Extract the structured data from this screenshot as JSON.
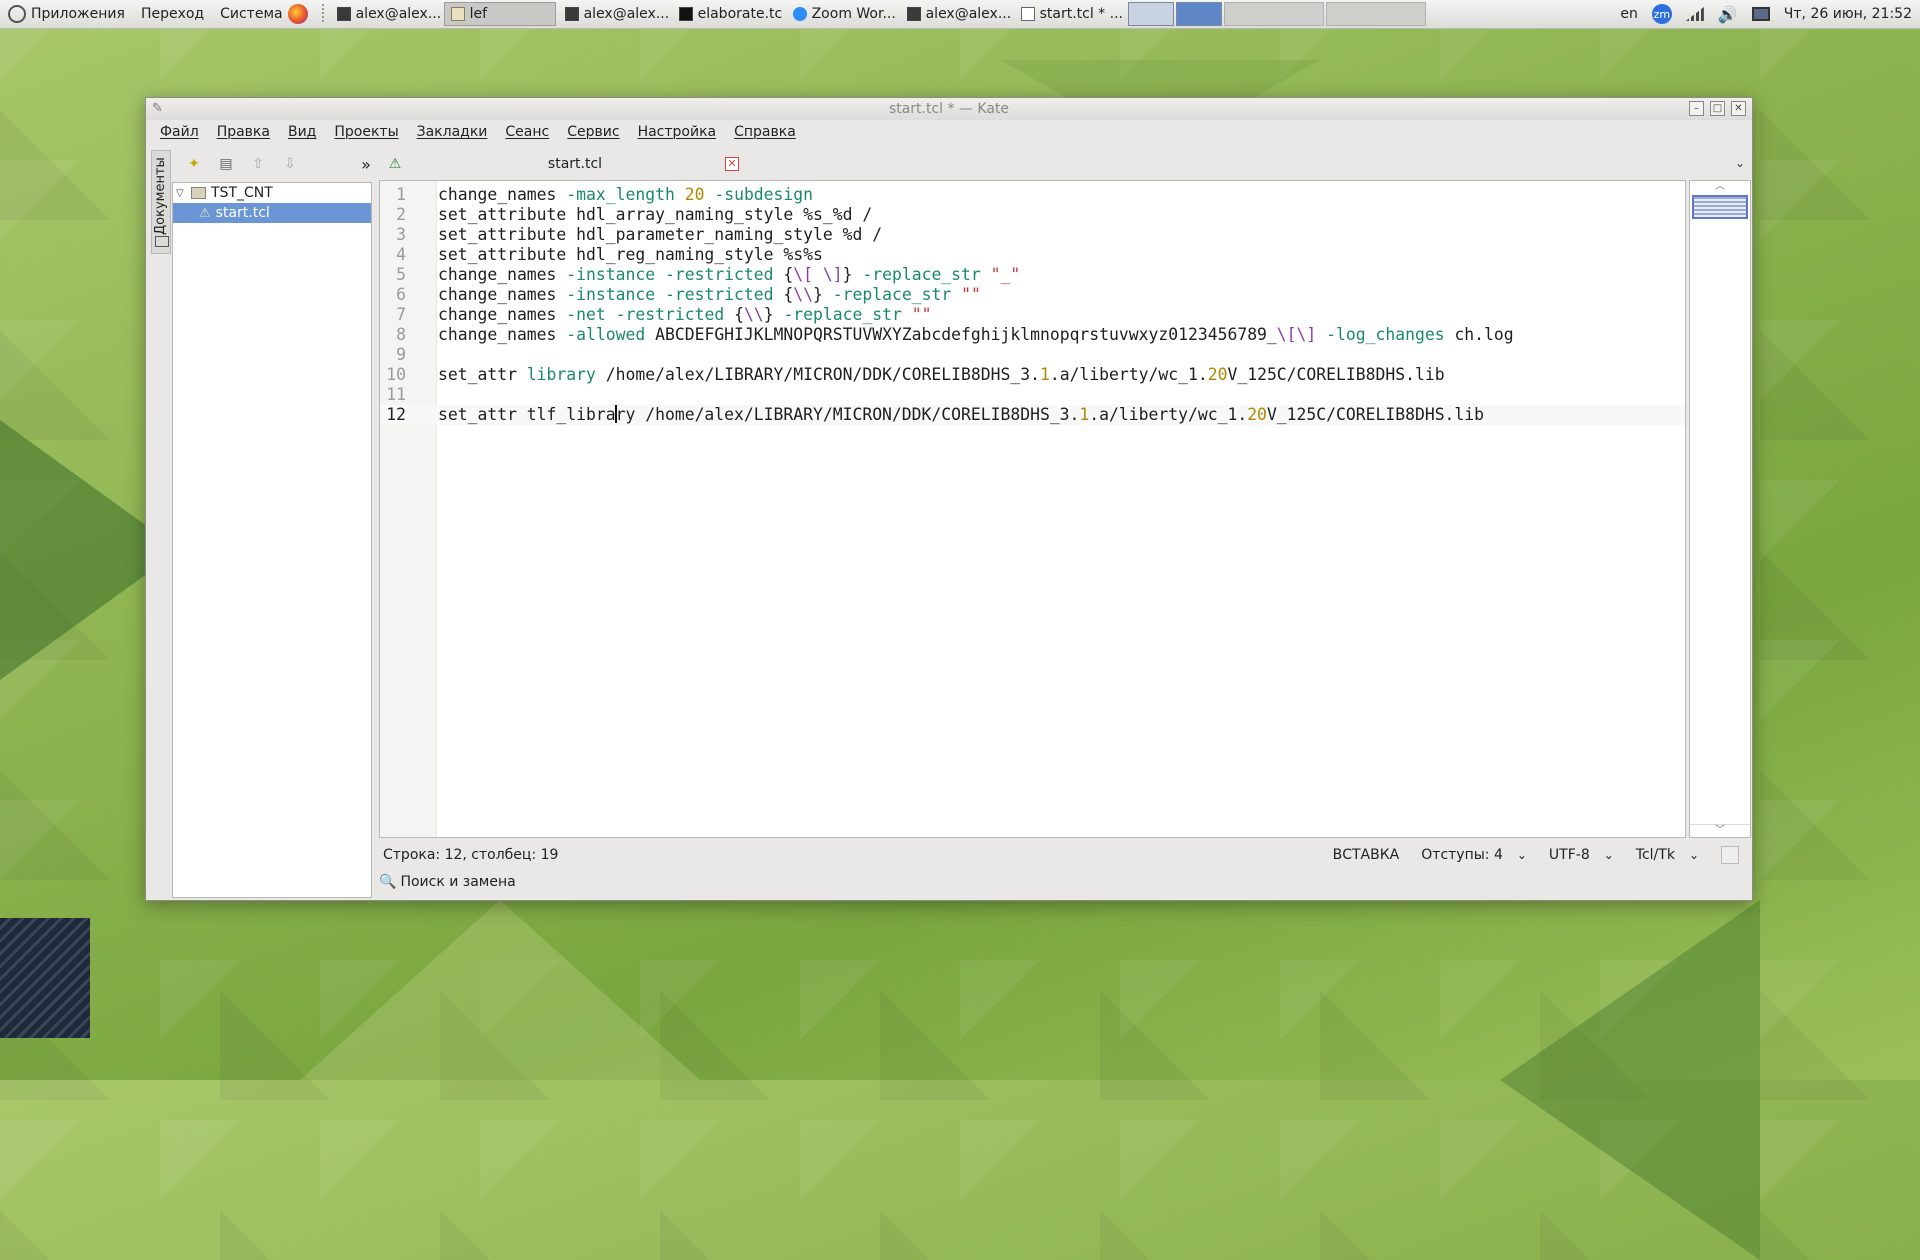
{
  "panel": {
    "menus": [
      "Приложения",
      "Переход",
      "Система"
    ],
    "tasks": [
      {
        "label": "alex@alex...",
        "icon": "terminal-icon"
      },
      {
        "label": "lef",
        "icon": "folder-icon"
      },
      {
        "label": "alex@alex...",
        "icon": "terminal-icon"
      },
      {
        "label": "elaborate.tcl",
        "icon": "terminal-icon"
      },
      {
        "label": "Zoom Wor...",
        "icon": "zoom-icon"
      },
      {
        "label": "alex@alex...",
        "icon": "terminal-icon"
      },
      {
        "label": "start.tcl * ...",
        "icon": "editor-icon"
      }
    ],
    "tray": {
      "lang": "en",
      "zm": "zm",
      "clock": "Чт, 26 июн, 21:52"
    }
  },
  "window": {
    "title": "start.tcl * — Kate",
    "menu": [
      "Файл",
      "Правка",
      "Вид",
      "Проекты",
      "Закладки",
      "Сеанс",
      "Сервис",
      "Настройка",
      "Справка"
    ]
  },
  "sidebar": {
    "tab_label": "Документы",
    "tree": {
      "folder": "TST_CNT",
      "file": "start.tcl"
    }
  },
  "editor": {
    "tab_label": "start.tcl",
    "cursor_line": 12,
    "lines": [
      {
        "n": "1",
        "parts": [
          [
            "",
            "change_names "
          ],
          [
            "kw",
            "-max_length "
          ],
          [
            "num",
            "20"
          ],
          [
            "kw",
            " -subdesign"
          ]
        ]
      },
      {
        "n": "2",
        "parts": [
          [
            "",
            "set_attribute hdl_array_naming_style %s_%d /"
          ]
        ]
      },
      {
        "n": "3",
        "parts": [
          [
            "",
            "set_attribute hdl_parameter_naming_style %d /"
          ]
        ]
      },
      {
        "n": "4",
        "parts": [
          [
            "",
            "set_attribute hdl_reg_naming_style %s%s"
          ]
        ]
      },
      {
        "n": "5",
        "parts": [
          [
            "",
            "change_names "
          ],
          [
            "kw",
            "-instance -restricted "
          ],
          [
            "",
            "{"
          ],
          [
            "esc",
            "\\[ \\]"
          ],
          [
            "",
            "} "
          ],
          [
            "kw",
            "-replace_str "
          ],
          [
            "str",
            "\"_\""
          ]
        ]
      },
      {
        "n": "6",
        "parts": [
          [
            "",
            "change_names "
          ],
          [
            "kw",
            "-instance -restricted "
          ],
          [
            "",
            "{"
          ],
          [
            "esc",
            "\\\\"
          ],
          [
            "",
            "} "
          ],
          [
            "kw",
            "-replace_str "
          ],
          [
            "str",
            "\"\""
          ]
        ]
      },
      {
        "n": "7",
        "parts": [
          [
            "",
            "change_names "
          ],
          [
            "kw",
            "-net -restricted "
          ],
          [
            "",
            "{"
          ],
          [
            "esc",
            "\\\\"
          ],
          [
            "",
            "} "
          ],
          [
            "kw",
            "-replace_str "
          ],
          [
            "str",
            "\"\""
          ]
        ]
      },
      {
        "n": "8",
        "parts": [
          [
            "",
            "change_names "
          ],
          [
            "kw",
            "-allowed "
          ],
          [
            "",
            "ABCDEFGHIJKLMNOPQRSTUVWXYZabcdefghijklmnopqrstuvwxyz0123456789_"
          ],
          [
            "esc",
            "\\[\\]"
          ],
          [
            "kw",
            " -log_changes "
          ],
          [
            "",
            "ch.log"
          ]
        ]
      },
      {
        "n": "9",
        "parts": []
      },
      {
        "n": "10",
        "parts": [
          [
            "",
            "set_attr "
          ],
          [
            "kw",
            "library"
          ],
          [
            "",
            " /home/alex/LIBRARY/MICRON/DDK/CORELIB8DHS_3."
          ],
          [
            "num",
            "1"
          ],
          [
            "",
            ".a/liberty/wc_1."
          ],
          [
            "num",
            "20"
          ],
          [
            "",
            "V_125C/CORELIB8DHS.lib"
          ]
        ]
      },
      {
        "n": "11",
        "parts": []
      },
      {
        "n": "12",
        "parts": [
          [
            "",
            "set_attr tlf_libra"
          ],
          [
            "caret",
            ""
          ],
          [
            "",
            "ry /home/alex/LIBRARY/MICRON/DDK/CORELIB8DHS_3."
          ],
          [
            "num",
            "1"
          ],
          [
            "",
            ".a/liberty/wc_1."
          ],
          [
            "num",
            "20"
          ],
          [
            "",
            "V_125C/CORELIB8DHS.lib"
          ]
        ]
      }
    ]
  },
  "status": {
    "position": "Строка: 12, столбец: 19",
    "mode": "ВСТАВКА",
    "indent": "Отступы: 4",
    "encoding": "UTF-8",
    "syntax": "Tcl/Tk",
    "search": "Поиск и замена"
  }
}
